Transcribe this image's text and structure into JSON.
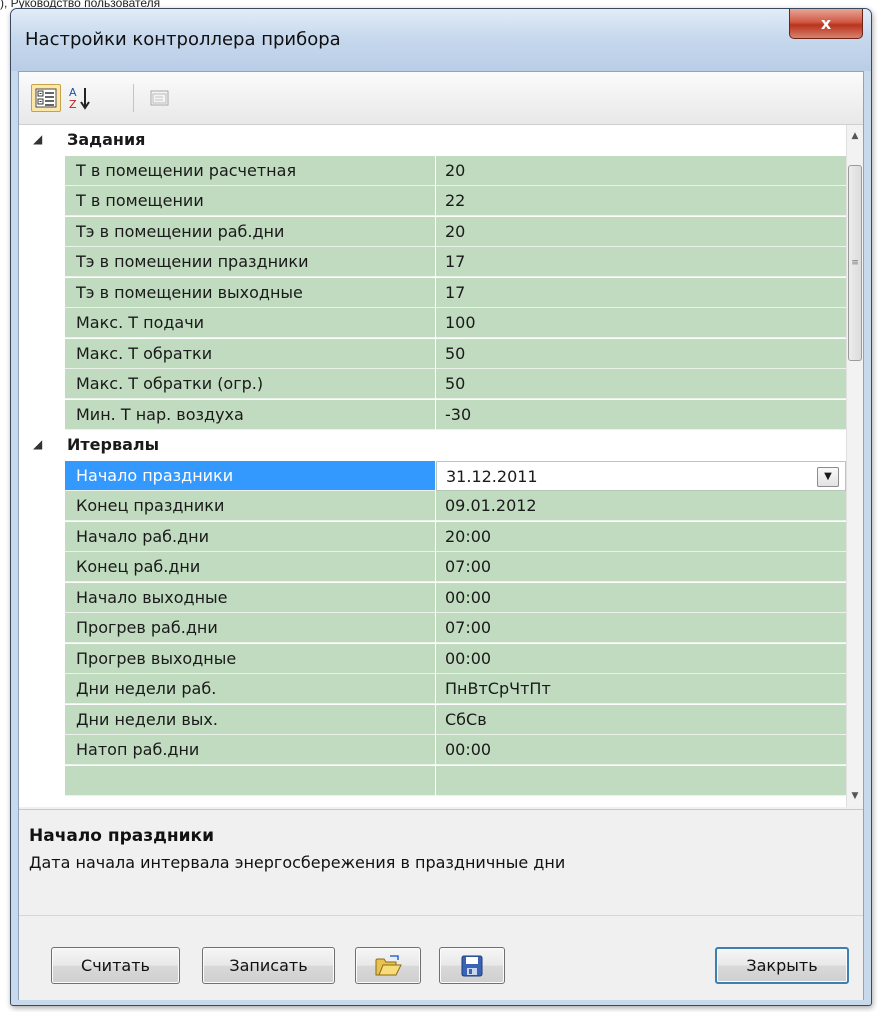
{
  "page_caption": "), Руководство пользователя",
  "window": {
    "title": "Настройки контроллера прибора",
    "close_glyph": "x"
  },
  "grid": {
    "categories": [
      {
        "label": "Задания",
        "properties": [
          {
            "name": "Т в помещении расчетная",
            "value": "20"
          },
          {
            "name": "Т в помещении",
            "value": "22"
          },
          {
            "name": "Тэ в помещении раб.дни",
            "value": "20"
          },
          {
            "name": "Тэ в помещении праздники",
            "value": "17"
          },
          {
            "name": "Тэ в помещении выходные",
            "value": "17"
          },
          {
            "name": "Макс. Т подачи",
            "value": "100"
          },
          {
            "name": "Макс. Т обратки",
            "value": "50"
          },
          {
            "name": "Макс. Т обратки (огр.)",
            "value": "50"
          },
          {
            "name": "Мин. Т нар. воздуха",
            "value": "-30"
          }
        ]
      },
      {
        "label": "Итервалы",
        "properties": [
          {
            "name": "Начало праздники",
            "value": "31.12.2011",
            "selected": true
          },
          {
            "name": "Конец праздники",
            "value": "09.01.2012"
          },
          {
            "name": "Начало раб.дни",
            "value": "20:00"
          },
          {
            "name": "Конец раб.дни",
            "value": "07:00"
          },
          {
            "name": "Начало выходные",
            "value": "00:00"
          },
          {
            "name": "Прогрев раб.дни",
            "value": "07:00"
          },
          {
            "name": "Прогрев выходные",
            "value": "00:00"
          },
          {
            "name": "Дни недели раб.",
            "value": "ПнВтСрЧтПт"
          },
          {
            "name": "Дни недели вых.",
            "value": "СбСв"
          },
          {
            "name": "Натоп раб.дни",
            "value": "00:00"
          },
          {
            "name": "",
            "value": ""
          }
        ]
      }
    ]
  },
  "help": {
    "title": "Начало праздники",
    "description": "Дата начала интервала энергосбережения в праздничные дни"
  },
  "buttons": {
    "read": "Считать",
    "write": "Записать",
    "close": "Закрыть"
  },
  "icons": {
    "toolbar": [
      "categorized-view-icon",
      "alphabetical-sort-icon",
      "property-pages-icon"
    ],
    "buttons": [
      "open-folder-icon",
      "save-disk-icon"
    ],
    "colors": {
      "row_background": "#c0dbbf",
      "selection": "#3399ff",
      "close_button": "#c9432c"
    }
  }
}
